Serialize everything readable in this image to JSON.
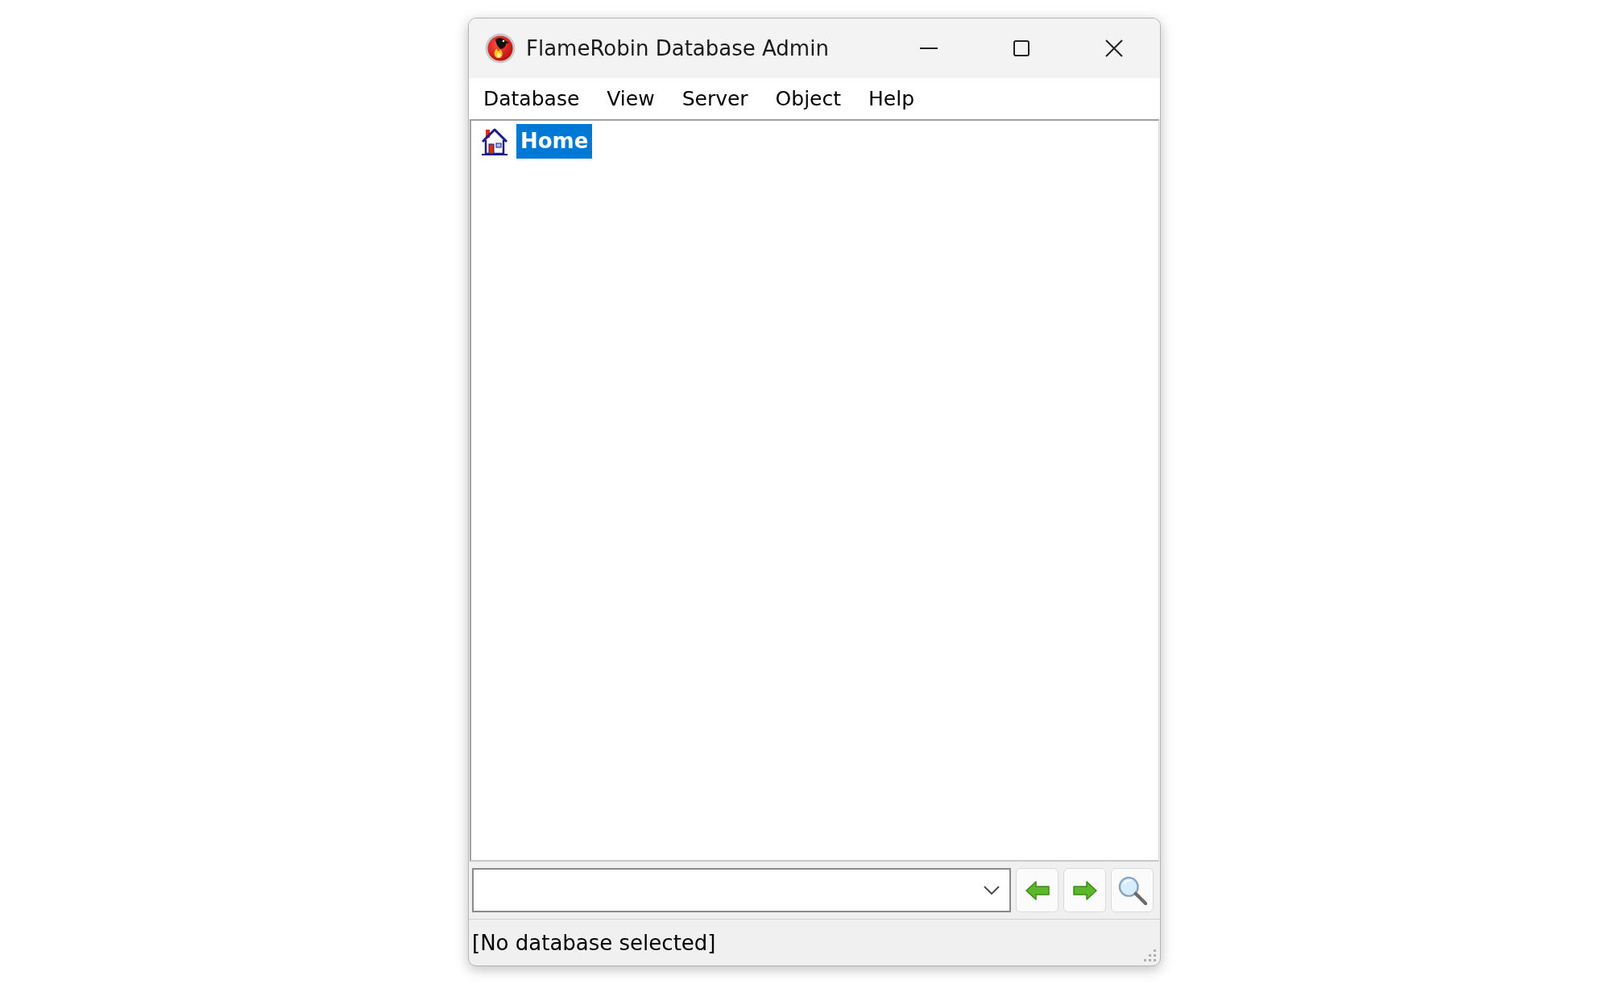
{
  "window": {
    "title": "FlameRobin Database Admin"
  },
  "menu_bar": [
    "Database",
    "View",
    "Server",
    "Object",
    "Help"
  ],
  "tree": {
    "items": [
      {
        "label": "Home",
        "selected": true
      }
    ]
  },
  "status_bar": {
    "text": "[No database selected]"
  }
}
